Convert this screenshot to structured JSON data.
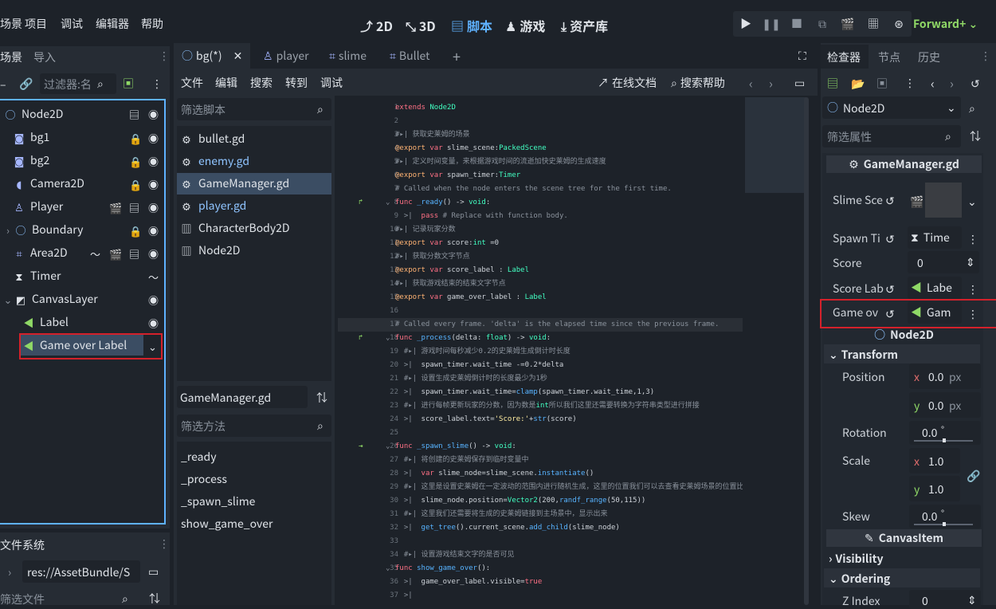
{
  "menu": {
    "scene": "场景",
    "project": "项目",
    "debug": "调试",
    "editor": "编辑器",
    "help": "帮助"
  },
  "modes": {
    "m2d": "2D",
    "m3d": "3D",
    "script": "脚本",
    "game": "游戏",
    "assetlib": "资产库"
  },
  "renderer": "Forward+",
  "left_dock": {
    "tabs": {
      "scene": "场景",
      "import": "导入"
    },
    "filter_placeholder": "过滤器:名",
    "nodes": [
      {
        "name": "Node2D"
      },
      {
        "name": "bg1"
      },
      {
        "name": "bg2"
      },
      {
        "name": "Camera2D"
      },
      {
        "name": "Player"
      },
      {
        "name": "Boundary"
      },
      {
        "name": "Area2D"
      },
      {
        "name": "Timer"
      },
      {
        "name": "CanvasLayer"
      },
      {
        "name": "Label"
      },
      {
        "name": "Game over Label"
      }
    ],
    "filesystem": {
      "title": "文件系统",
      "path": "res://AssetBundle/S",
      "filter": "筛选文件"
    }
  },
  "editor_tabs": [
    {
      "label": "bg(*)"
    },
    {
      "label": "player"
    },
    {
      "label": "slime"
    },
    {
      "label": "Bullet"
    }
  ],
  "script_menu": {
    "file": "文件",
    "edit": "编辑",
    "search": "搜索",
    "goto": "转到",
    "debug": "调试",
    "online_docs": "在线文档",
    "search_help": "搜索帮助"
  },
  "script_panel": {
    "filter_scripts": "筛选脚本",
    "scripts": [
      {
        "name": "bullet.gd"
      },
      {
        "name": "enemy.gd"
      },
      {
        "name": "GameManager.gd"
      },
      {
        "name": "player.gd"
      },
      {
        "name": "CharacterBody2D"
      },
      {
        "name": "Node2D"
      }
    ],
    "current_script": "GameManager.gd",
    "filter_methods": "筛选方法",
    "methods": [
      "_ready",
      "_process",
      "_spawn_slime",
      "show_game_over"
    ]
  },
  "code_lines": [
    {
      "n": "1",
      "t": "extends Node2D"
    },
    {
      "n": "2",
      "t": ""
    },
    {
      "n": "3",
      "t": "#▸| 获取史莱姆的场景"
    },
    {
      "n": "4",
      "t": "@export var slime_scene:PackedScene"
    },
    {
      "n": "5",
      "t": "#▸| 定义时间变量，来根据游戏时间的流逝加快史莱姆的生成速度"
    },
    {
      "n": "6",
      "t": "@export var spawn_timer:Timer"
    },
    {
      "n": "7",
      "t": "# Called when the node enters the scene tree for the first time."
    },
    {
      "n": "8",
      "t": "func _ready() -> void:"
    },
    {
      "n": "9",
      "t": "  >|  pass # Replace with function body."
    },
    {
      "n": "10",
      "t": "#▸| 记录玩家分数"
    },
    {
      "n": "11",
      "t": "@export var score:int =0"
    },
    {
      "n": "12",
      "t": "#▸| 获取分数文字节点"
    },
    {
      "n": "13",
      "t": "@export var score_label : Label"
    },
    {
      "n": "14",
      "t": "#▸| 获取游戏结束的结束文字节点"
    },
    {
      "n": "15",
      "t": "@export var game_over_label : Label"
    },
    {
      "n": "16",
      "t": ""
    },
    {
      "n": "17",
      "t": "# Called every frame. 'delta' is the elapsed time since the previous frame."
    },
    {
      "n": "18",
      "t": "func _process(delta: float) -> void:"
    },
    {
      "n": "19",
      "t": "  #▸| 游戏时间每秒减少0.2的史莱姆生成倒计时长度"
    },
    {
      "n": "20",
      "t": "  >|  spawn_timer.wait_time -=0.2*delta"
    },
    {
      "n": "21",
      "t": "  #▸| 设置生成史莱姆倒计时的长度最少为1秒"
    },
    {
      "n": "22",
      "t": "  >|  spawn_timer.wait_time=clamp(spawn_timer.wait_time,1,3)"
    },
    {
      "n": "23",
      "t": "  #▸| 进行每帧更新玩家的分数，因为数是int所以我们这里还需要转换为字符串类型进行拼接"
    },
    {
      "n": "24",
      "t": "  >|  score_label.text='Score:'+str(score)"
    },
    {
      "n": "25",
      "t": ""
    },
    {
      "n": "26",
      "t": "func _spawn_slime() -> void:"
    },
    {
      "n": "27",
      "t": "  #▸| 将创建的史莱姆保存到临时变量中"
    },
    {
      "n": "28",
      "t": "  >|  var slime_node=slime_scene.instantiate()"
    },
    {
      "n": "29",
      "t": "  #▸| 这里是设置史莱姆在一定波动的范围内进行随机生成，这里的位置我们可以去查看史莱姆场景的位置比划"
    },
    {
      "n": "30",
      "t": "  >|  slime_node.position=Vector2(200,randf_range(50,115))"
    },
    {
      "n": "31",
      "t": "  #▸| 这里我们还需要将生成的史莱姆链接到主场景中，显示出来"
    },
    {
      "n": "32",
      "t": "  >|  get_tree().current_scene.add_child(slime_node)"
    },
    {
      "n": "33",
      "t": ""
    },
    {
      "n": "34",
      "t": "  #▸| 设置游戏结束文字的是否可见"
    },
    {
      "n": "35",
      "t": "func show_game_over():"
    },
    {
      "n": "36",
      "t": "  >|  game_over_label.visible=true"
    },
    {
      "n": "37",
      "t": "  >|"
    }
  ],
  "inspector": {
    "tabs": {
      "inspector": "检查器",
      "node": "节点",
      "history": "历史"
    },
    "node_type": "Node2D",
    "filter_props": "筛选属性",
    "script_header": "GameManager.gd",
    "props": {
      "slime_scene": "Slime Sce",
      "spawn_timer": "Spawn Ti",
      "spawn_timer_val": "Time",
      "score": "Score",
      "score_val": "0",
      "score_label": "Score Lab",
      "score_label_val": "Labe",
      "game_over": "Game ov",
      "game_over_val": "Gam"
    },
    "node2d_header": "Node2D",
    "transform": "Transform",
    "position": "Position",
    "pos_x": "0.0",
    "pos_y": "0.0",
    "unit_px": "px",
    "rotation": "Rotation",
    "rot_val": "0.0",
    "deg": "°",
    "scale": "Scale",
    "scale_x": "1.0",
    "scale_y": "1.0",
    "skew": "Skew",
    "skew_val": "0.0",
    "canvasitem_header": "CanvasItem",
    "visibility": "Visibility",
    "ordering": "Ordering",
    "zindex": "Z Index",
    "zindex_val": "0"
  },
  "colors": {
    "accent": "#5fb2ff",
    "highlight_red": "#d4212b",
    "renderer_green": "#8fd866"
  }
}
